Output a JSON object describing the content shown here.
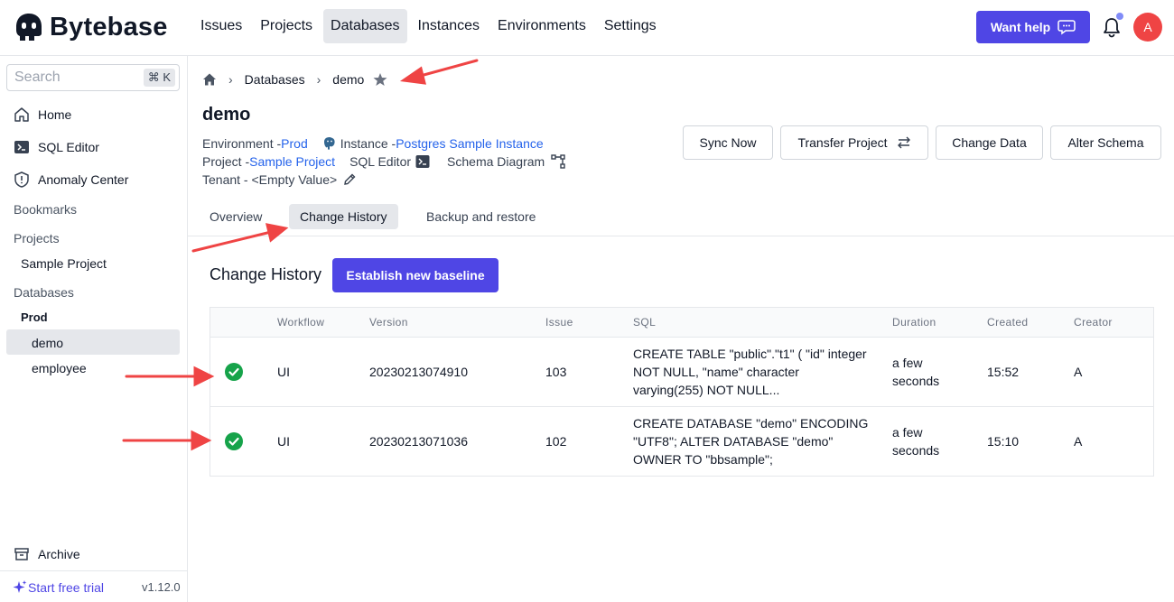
{
  "app": {
    "name": "Bytebase",
    "nav": [
      "Issues",
      "Projects",
      "Databases",
      "Instances",
      "Environments",
      "Settings"
    ],
    "active_nav": "Databases",
    "help_label": "Want help",
    "avatar_initial": "A",
    "accent_color": "#4f46e5"
  },
  "sidebar": {
    "search_placeholder": "Search",
    "search_shortcut": "⌘ K",
    "items": [
      {
        "label": "Home",
        "icon": "home-icon"
      },
      {
        "label": "SQL Editor",
        "icon": "terminal-icon"
      },
      {
        "label": "Anomaly Center",
        "icon": "shield-icon"
      }
    ],
    "bookmarks_label": "Bookmarks",
    "projects_label": "Projects",
    "projects": [
      "Sample Project"
    ],
    "databases_label": "Databases",
    "environment_group": "Prod",
    "databases": [
      "demo",
      "employee"
    ],
    "selected_database": "demo",
    "archive_label": "Archive",
    "trial_label": "Start free trial",
    "version": "v1.12.0"
  },
  "breadcrumb": {
    "items": [
      "Databases",
      "demo"
    ]
  },
  "database": {
    "name": "demo",
    "environment_label": "Environment - ",
    "environment_value": "Prod",
    "instance_label": "Instance - ",
    "instance_value": "Postgres Sample Instance",
    "project_label": "Project - ",
    "project_value": "Sample Project",
    "sql_editor_label": "SQL Editor",
    "schema_diagram_label": "Schema Diagram",
    "tenant_label": "Tenant - <Empty Value>"
  },
  "actions": [
    "Sync Now",
    "Transfer Project",
    "Change Data",
    "Alter Schema"
  ],
  "tabs": {
    "items": [
      "Overview",
      "Change History",
      "Backup and restore"
    ],
    "active": "Change History"
  },
  "change_history": {
    "title": "Change History",
    "baseline_button": "Establish new baseline",
    "columns": [
      "Workflow",
      "Version",
      "Issue",
      "SQL",
      "Duration",
      "Created",
      "Creator"
    ],
    "rows": [
      {
        "status": "success",
        "workflow": "UI",
        "version": "20230213074910",
        "issue": "103",
        "sql": [
          "CREATE TABLE \"public\".\"t1\" ( \"id\" integer",
          "NOT NULL, \"name\" character",
          "varying(255) NOT NULL..."
        ],
        "duration": [
          "a few",
          "seconds"
        ],
        "created": "15:52",
        "creator": "A"
      },
      {
        "status": "success",
        "workflow": "UI",
        "version": "20230213071036",
        "issue": "102",
        "sql": [
          "CREATE DATABASE \"demo\" ENCODING",
          "\"UTF8\"; ALTER DATABASE \"demo\"",
          "OWNER TO \"bbsample\";"
        ],
        "duration": [
          "a few",
          "seconds"
        ],
        "created": "15:10",
        "creator": "A"
      }
    ]
  },
  "annotation_color": "#ef4444",
  "success_color": "#16a34a"
}
